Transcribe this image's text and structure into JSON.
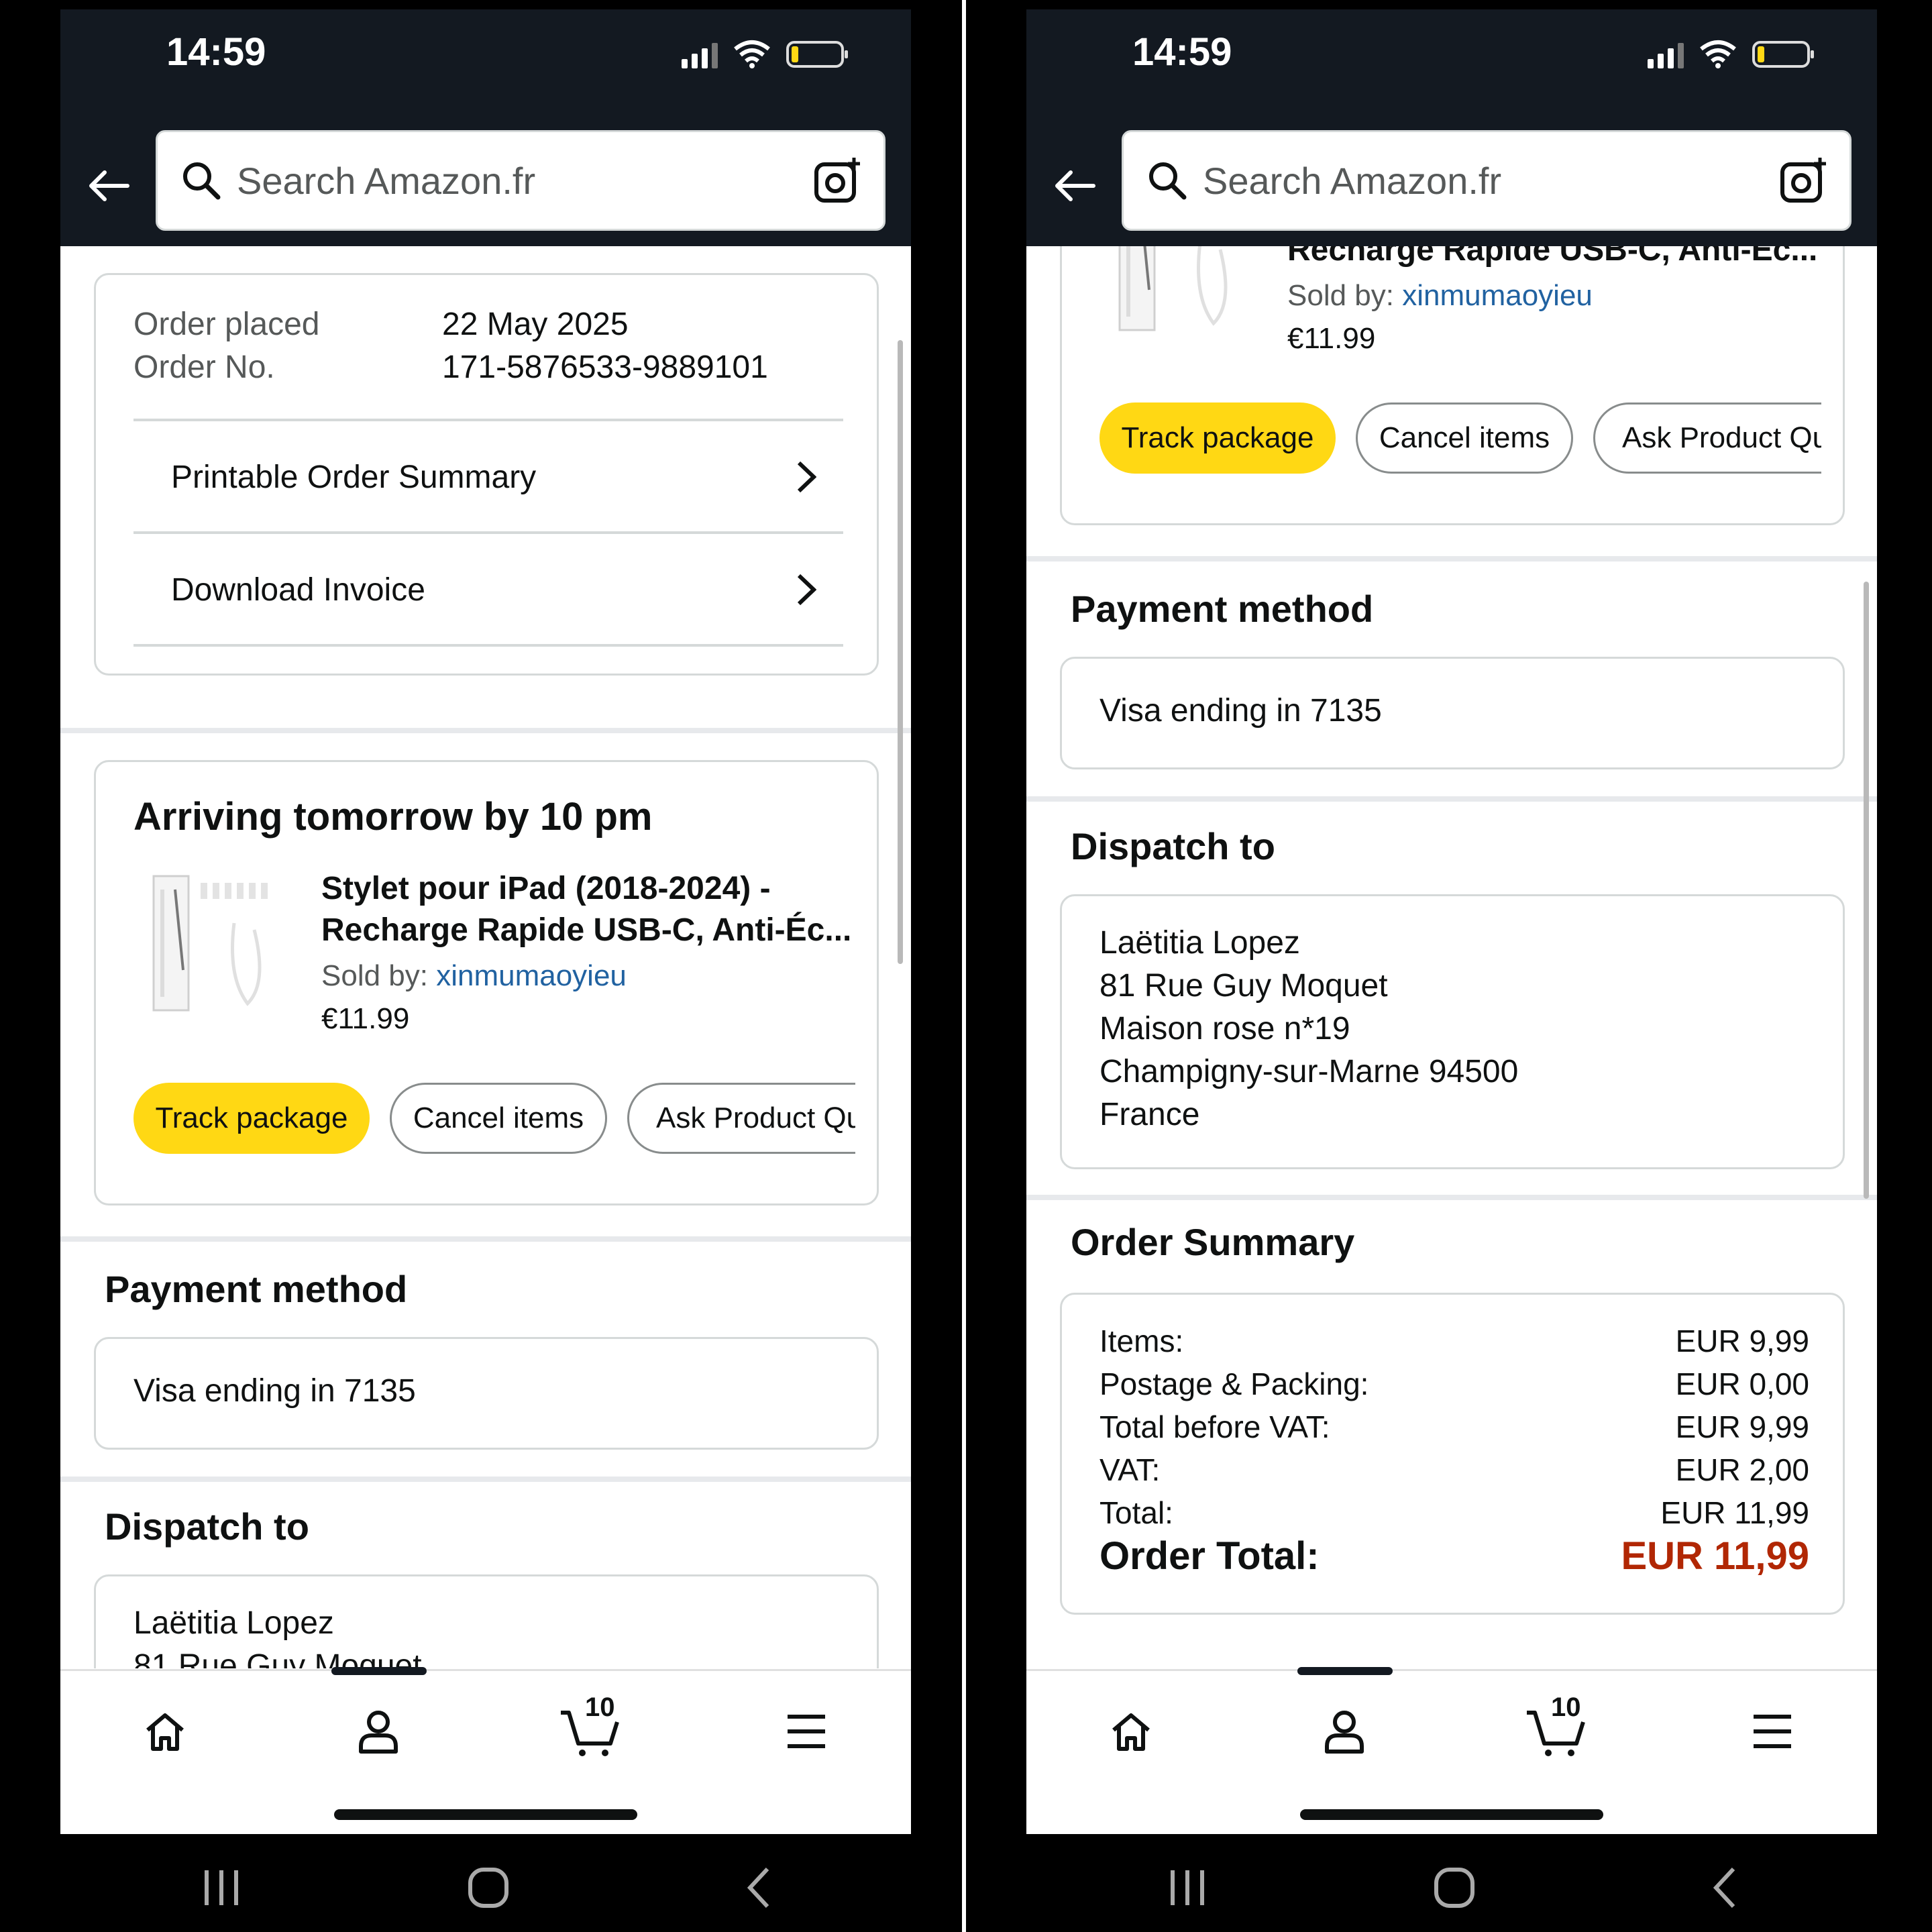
{
  "status": {
    "time": "14:59"
  },
  "search": {
    "placeholder": "Search Amazon.fr"
  },
  "order": {
    "placed_label": "Order placed",
    "placed_value": "22 May 2025",
    "number_label": "Order No.",
    "number_value": "171-5876533-9889101",
    "links": [
      "Printable Order Summary",
      "Download Invoice"
    ]
  },
  "shipment": {
    "arrival": "Arriving tomorrow by 10 pm",
    "product_line1": "Stylet pour iPad (2018-2024) -",
    "product_line2": "Recharge Rapide USB-C, Anti-Éc...",
    "sold_by_label": "Sold by:",
    "seller": "xinmumaoyieu",
    "price": "€11.99",
    "buttons": {
      "track": "Track package",
      "cancel": "Cancel items",
      "ask": "Ask Product Questions"
    }
  },
  "payment": {
    "title": "Payment method",
    "method": "Visa  ending in 7135"
  },
  "dispatch": {
    "title": "Dispatch to",
    "lines": [
      "Laëtitia Lopez",
      "81 Rue Guy Moquet",
      "Maison rose n*19",
      "Champigny-sur-Marne 94500",
      "France"
    ]
  },
  "summary": {
    "title": "Order Summary",
    "rows": [
      {
        "label": "Items:",
        "value": "EUR 9,99"
      },
      {
        "label": "Postage & Packing:",
        "value": "EUR 0,00"
      },
      {
        "label": "Total before VAT:",
        "value": "EUR 9,99"
      },
      {
        "label": "VAT:",
        "value": "EUR 2,00"
      },
      {
        "label": "Total:",
        "value": "EUR 11,99"
      }
    ],
    "order_total_label": "Order Total:",
    "order_total_value": "EUR 11,99"
  },
  "nav": {
    "cart_count": "10",
    "items": [
      "home-icon",
      "account-icon",
      "cart-icon",
      "menu-icon"
    ]
  },
  "colors": {
    "header": "#131921",
    "primary_button": "#ffd814",
    "link": "#2162a1",
    "order_total": "#b12704"
  }
}
